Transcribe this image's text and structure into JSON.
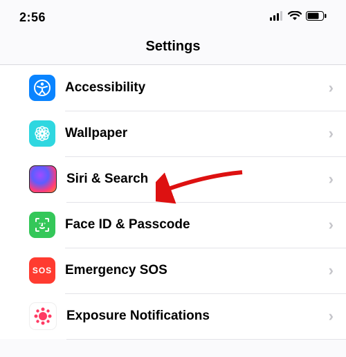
{
  "status": {
    "time": "2:56"
  },
  "header": {
    "title": "Settings"
  },
  "rows": [
    {
      "label": "Accessibility"
    },
    {
      "label": "Wallpaper"
    },
    {
      "label": "Siri & Search"
    },
    {
      "label": "Face ID & Passcode"
    },
    {
      "label": "Emergency SOS"
    },
    {
      "label": "Exposure Notifications"
    }
  ],
  "sos": "SOS"
}
